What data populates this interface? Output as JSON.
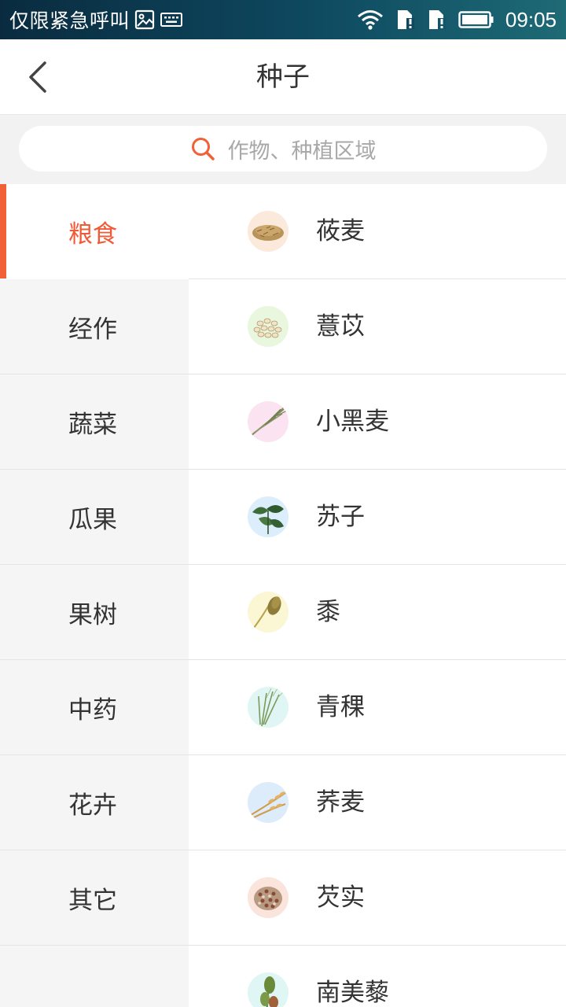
{
  "status_bar": {
    "carrier_text": "仅限紧急呼叫",
    "time": "09:05",
    "icons": [
      "image-icon",
      "keyboard-icon",
      "wifi-icon",
      "sim1-alert-icon",
      "sim2-alert-icon",
      "battery-icon"
    ]
  },
  "header": {
    "title": "种子",
    "back_icon": "chevron-left-icon"
  },
  "search": {
    "icon": "search-icon",
    "placeholder": "作物、种植区域"
  },
  "colors": {
    "accent": "#f26037",
    "text": "#333333",
    "placeholder": "#a8a8a8",
    "sidebar_bg": "#f5f5f5",
    "divider": "#e4e4e4"
  },
  "categories": [
    {
      "label": "粮食",
      "selected": true
    },
    {
      "label": "经作",
      "selected": false
    },
    {
      "label": "蔬菜",
      "selected": false
    },
    {
      "label": "瓜果",
      "selected": false
    },
    {
      "label": "果树",
      "selected": false
    },
    {
      "label": "中药",
      "selected": false
    },
    {
      "label": "花卉",
      "selected": false
    },
    {
      "label": "其它",
      "selected": false
    }
  ],
  "crops": [
    {
      "label": "莜麦",
      "icon": "oat-grain-icon",
      "bg": "#fbe9dc"
    },
    {
      "label": "薏苡",
      "icon": "job-tears-seed-icon",
      "bg": "#e9f7df"
    },
    {
      "label": "小黑麦",
      "icon": "triticale-ear-icon",
      "bg": "#fbe3f1"
    },
    {
      "label": "苏子",
      "icon": "perilla-leaf-icon",
      "bg": "#dceefb"
    },
    {
      "label": "黍",
      "icon": "millet-panicle-icon",
      "bg": "#fbf6d4"
    },
    {
      "label": "青稞",
      "icon": "highland-barley-icon",
      "bg": "#e0f6f4"
    },
    {
      "label": "荞麦",
      "icon": "buckwheat-ear-icon",
      "bg": "#dcecfb"
    },
    {
      "label": "芡实",
      "icon": "fox-nut-seed-icon",
      "bg": "#fbe4dc"
    },
    {
      "label": "南美藜",
      "icon": "quinoa-plant-icon",
      "bg": "#e0f6f4"
    }
  ]
}
